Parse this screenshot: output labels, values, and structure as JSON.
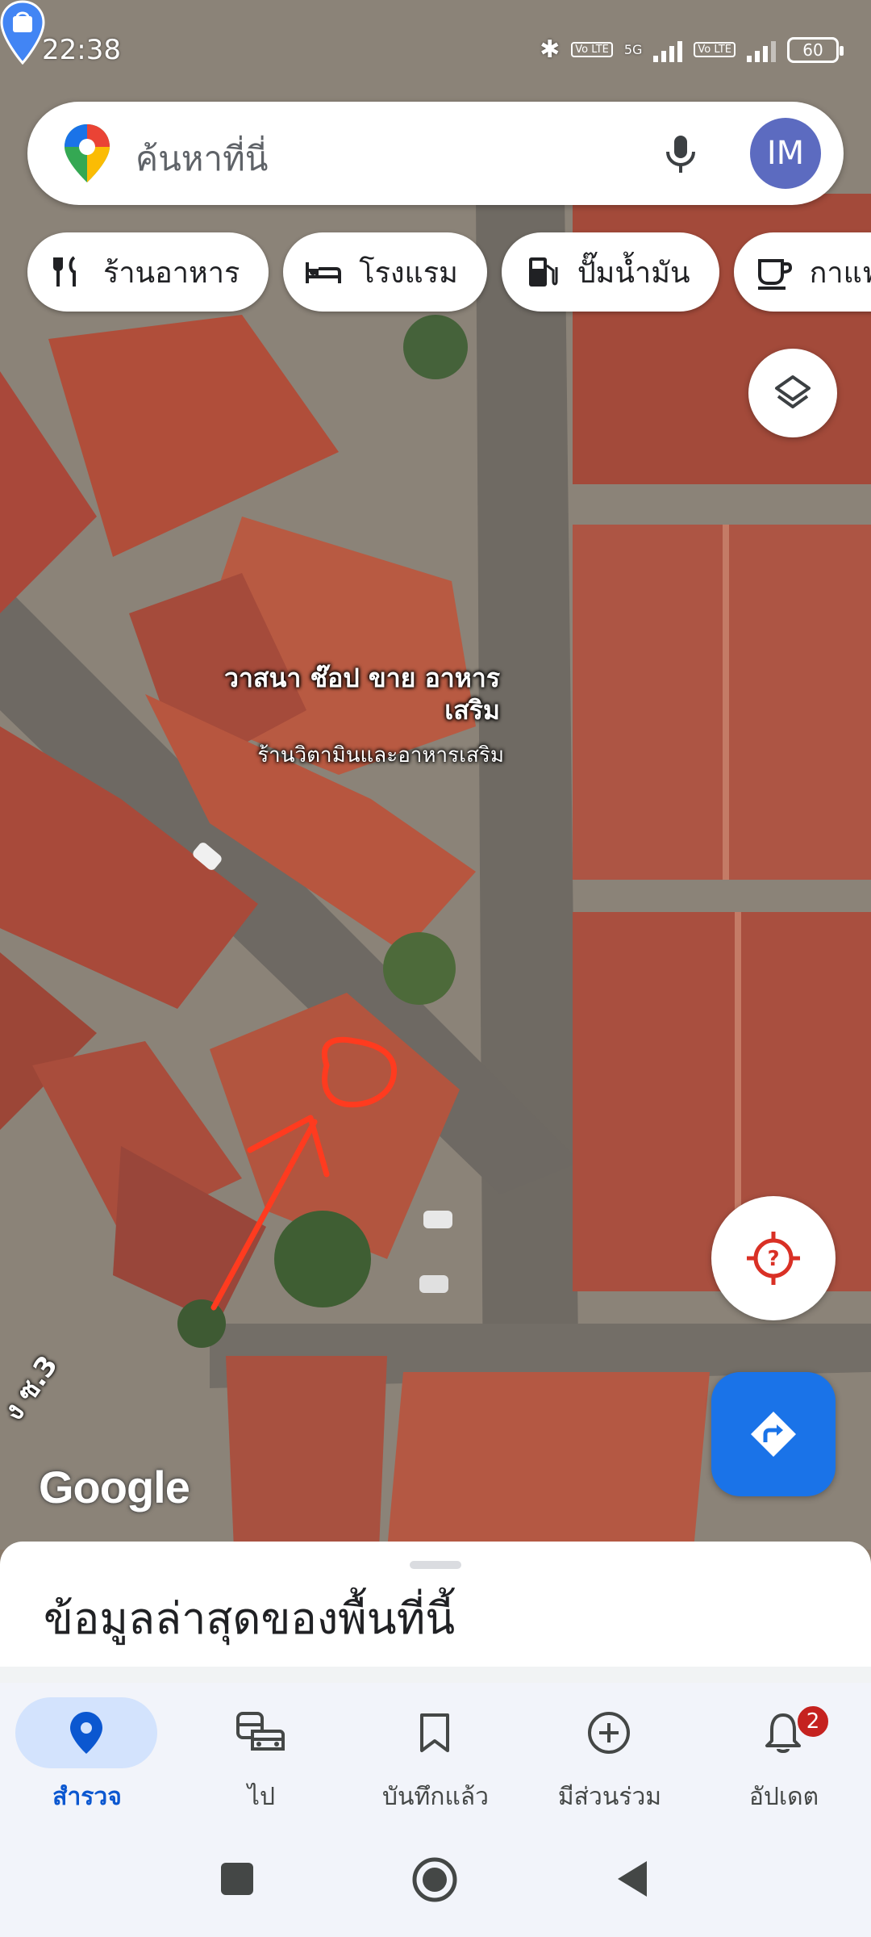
{
  "status_bar": {
    "time": "22:38",
    "network": "5G",
    "volte_label": "Vo LTE",
    "battery": "60"
  },
  "search": {
    "placeholder": "ค้นหาที่นี่",
    "avatar_initials": "IM"
  },
  "chips": [
    {
      "label": "ร้านอาหาร",
      "icon": "restaurant-icon"
    },
    {
      "label": "โรงแรม",
      "icon": "hotel-icon"
    },
    {
      "label": "ปั๊มน้ำมัน",
      "icon": "gas-station-icon"
    },
    {
      "label": "กาแฟ",
      "icon": "coffee-icon"
    }
  ],
  "map": {
    "poi_name": "วาสนา ช๊อป ขาย อาหารเสริม",
    "poi_category": "ร้านวิตามินและอาหารเสริม",
    "street_label": "ง ซ.3",
    "watermark": "Google",
    "annotation": "red-hand-drawn-circle-and-arrow"
  },
  "bottom_sheet": {
    "title": "ข้อมูลล่าสุดของพื้นที่นี้"
  },
  "bottom_nav": {
    "items": [
      {
        "label": "สำรวจ",
        "icon": "explore-pin-icon",
        "active": true
      },
      {
        "label": "ไป",
        "icon": "commute-icon",
        "active": false
      },
      {
        "label": "บันทึกแล้ว",
        "icon": "bookmark-icon",
        "active": false
      },
      {
        "label": "มีส่วนร่วม",
        "icon": "contribute-icon",
        "active": false
      },
      {
        "label": "อัปเดต",
        "icon": "bell-icon",
        "active": false
      }
    ],
    "updates_badge": "2"
  },
  "colors": {
    "accent": "#1a73e8",
    "nav_active_bg": "#d3e3fd",
    "nav_active_text": "#0b57d0",
    "badge": "#c5221f",
    "annotation": "#ff3b1f",
    "location_icon": "#d93025"
  }
}
